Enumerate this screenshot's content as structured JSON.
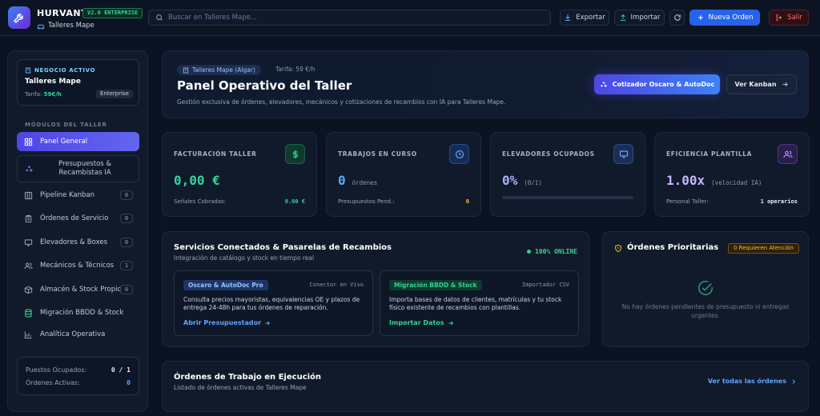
{
  "app": {
    "brand": "HURVANT",
    "version": "V2.6 ENTERPRISE",
    "workshop": "Talleres Mape"
  },
  "search": {
    "placeholder": "Buscar en Talleres Mape..."
  },
  "toolbar": {
    "export_label": "Exportar",
    "import_label": "Importar",
    "new_order_label": "Nueva Orden",
    "exit_label": "Salir"
  },
  "sidebar": {
    "business": {
      "label": "NEGOCIO ACTIVO",
      "name": "Talleres Mape",
      "rate_label": "Tarifa:",
      "rate_value": "59€/h",
      "plan": "Enterprise"
    },
    "section_title": "MÓDULOS DEL TALLER",
    "items": [
      {
        "label": "Panel General",
        "icon": "grid-icon",
        "count": ""
      },
      {
        "label": "Presupuestos & Recambistas IA",
        "icon": "sparkles-icon",
        "count": ""
      },
      {
        "label": "Pipeline Kanban",
        "icon": "kanban-icon",
        "count": "0"
      },
      {
        "label": "Órdenes de Servicio",
        "icon": "clipboard-icon",
        "count": "0"
      },
      {
        "label": "Elevadores & Boxes",
        "icon": "monitor-icon",
        "count": "0"
      },
      {
        "label": "Mecánicos & Técnicos",
        "icon": "users-icon",
        "count": "1"
      },
      {
        "label": "Almacén & Stock Propio",
        "icon": "box-icon",
        "count": "0"
      },
      {
        "label": "Migración BBDD & Stock",
        "icon": "database-icon",
        "count": ""
      },
      {
        "label": "Analítica Operativa",
        "icon": "chart-icon",
        "count": ""
      }
    ],
    "stats": [
      {
        "label": "Puestos Ocupados:",
        "value": "0 / 1"
      },
      {
        "label": "Órdenes Activas:",
        "value": "0"
      }
    ]
  },
  "hero": {
    "pill": "Talleres Mape (Algar)",
    "rate": "Tarifa: 59 €/h",
    "title": "Panel Operativo del Taller",
    "subtitle": "Gestión exclusiva de órdenes, elevadores, mecánicos y cotizaciones de recambios con IA para Talleres Mape.",
    "quote_button": "Cotizador Oscaro & AutoDoc",
    "kanban_button": "Ver Kanban"
  },
  "kpis": [
    {
      "title": "FACTURACIÓN TALLER",
      "value": "0,00 €",
      "unit": "",
      "foot_label": "Señales Cobradas:",
      "foot_value": "0.00 €",
      "icon": "dollar-icon"
    },
    {
      "title": "TRABAJOS EN CURSO",
      "value": "0",
      "unit": "órdenes",
      "foot_label": "Presupuestos Pend.:",
      "foot_value": "0",
      "icon": "clock-icon"
    },
    {
      "title": "ELEVADORES OCUPADOS",
      "value": "0%",
      "unit": "(0/1)",
      "progress": 0,
      "icon": "monitor-icon"
    },
    {
      "title": "EFICIENCIA PLANTILLA",
      "value": "1.00x",
      "unit": "(velocidad IA)",
      "foot_label": "Personal Taller:",
      "foot_value": "1 operarios",
      "icon": "users-icon"
    }
  ],
  "services": {
    "title": "Servicios Conectados & Pasarelas de Recambios",
    "subtitle": "Integración de catálogo y stock en tiempo real",
    "status": "100% ONLINE",
    "cards": [
      {
        "tag": "Oscaro & AutoDoc Pro",
        "kind": "Conector en Vivo",
        "desc": "Consulta precios mayoristas, equivalencias OE y plazos de entrega 24-48h para tus órdenes de reparación.",
        "link": "Abrir Presupuestador"
      },
      {
        "tag": "Migración BBDD & Stock",
        "kind": "Importador CSV",
        "desc": "Importa bases de datos de clientes, matrículas y tu stock físico existente de recambios con plantillas.",
        "link": "Importar Datos"
      }
    ]
  },
  "priority": {
    "title": "Órdenes Prioritarias",
    "badge": "0 Requieren Atención",
    "empty": "No hay órdenes pendientes de presupuesto ni entregas urgentes."
  },
  "orders": {
    "title": "Órdenes de Trabajo en Ejecución",
    "subtitle": "Listado de órdenes activas de Talleres Mape",
    "link": "Ver todas las órdenes"
  },
  "colors": {
    "accent": "#4f46e5",
    "primary": "#2563eb",
    "success": "#34d399",
    "warning": "#fbbf24",
    "danger": "#f87171",
    "background": "#0b1322"
  }
}
